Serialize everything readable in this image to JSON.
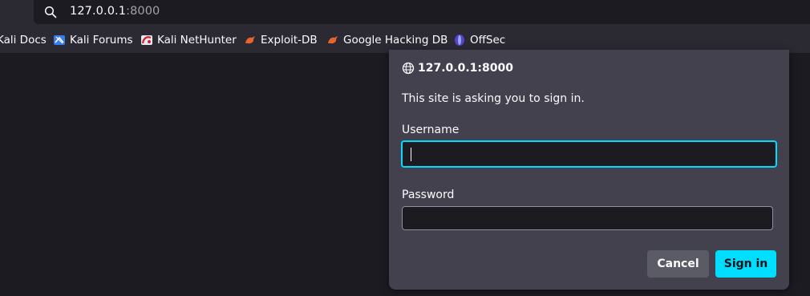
{
  "browser": {
    "url_host": "127.0.0.1",
    "url_port": ":8000"
  },
  "bookmarks": [
    {
      "label": "Kali Docs",
      "icon": "kali-docs-icon"
    },
    {
      "label": "Kali Forums",
      "icon": "kali-forums-icon"
    },
    {
      "label": "Kali NetHunter",
      "icon": "kali-nethunter-icon"
    },
    {
      "label": "Exploit-DB",
      "icon": "exploit-db-icon"
    },
    {
      "label": "Google Hacking DB",
      "icon": "exploit-db-icon"
    },
    {
      "label": "OffSec",
      "icon": "offsec-icon"
    }
  ],
  "auth_dialog": {
    "origin": "127.0.0.1:8000",
    "message": "This site is asking you to sign in.",
    "username_label": "Username",
    "username_value": "",
    "password_label": "Password",
    "password_value": "",
    "cancel_label": "Cancel",
    "signin_label": "Sign in"
  },
  "colors": {
    "accent": "#00ddff",
    "dialog_bg": "#42414d",
    "page_bg": "#1c1b22"
  }
}
